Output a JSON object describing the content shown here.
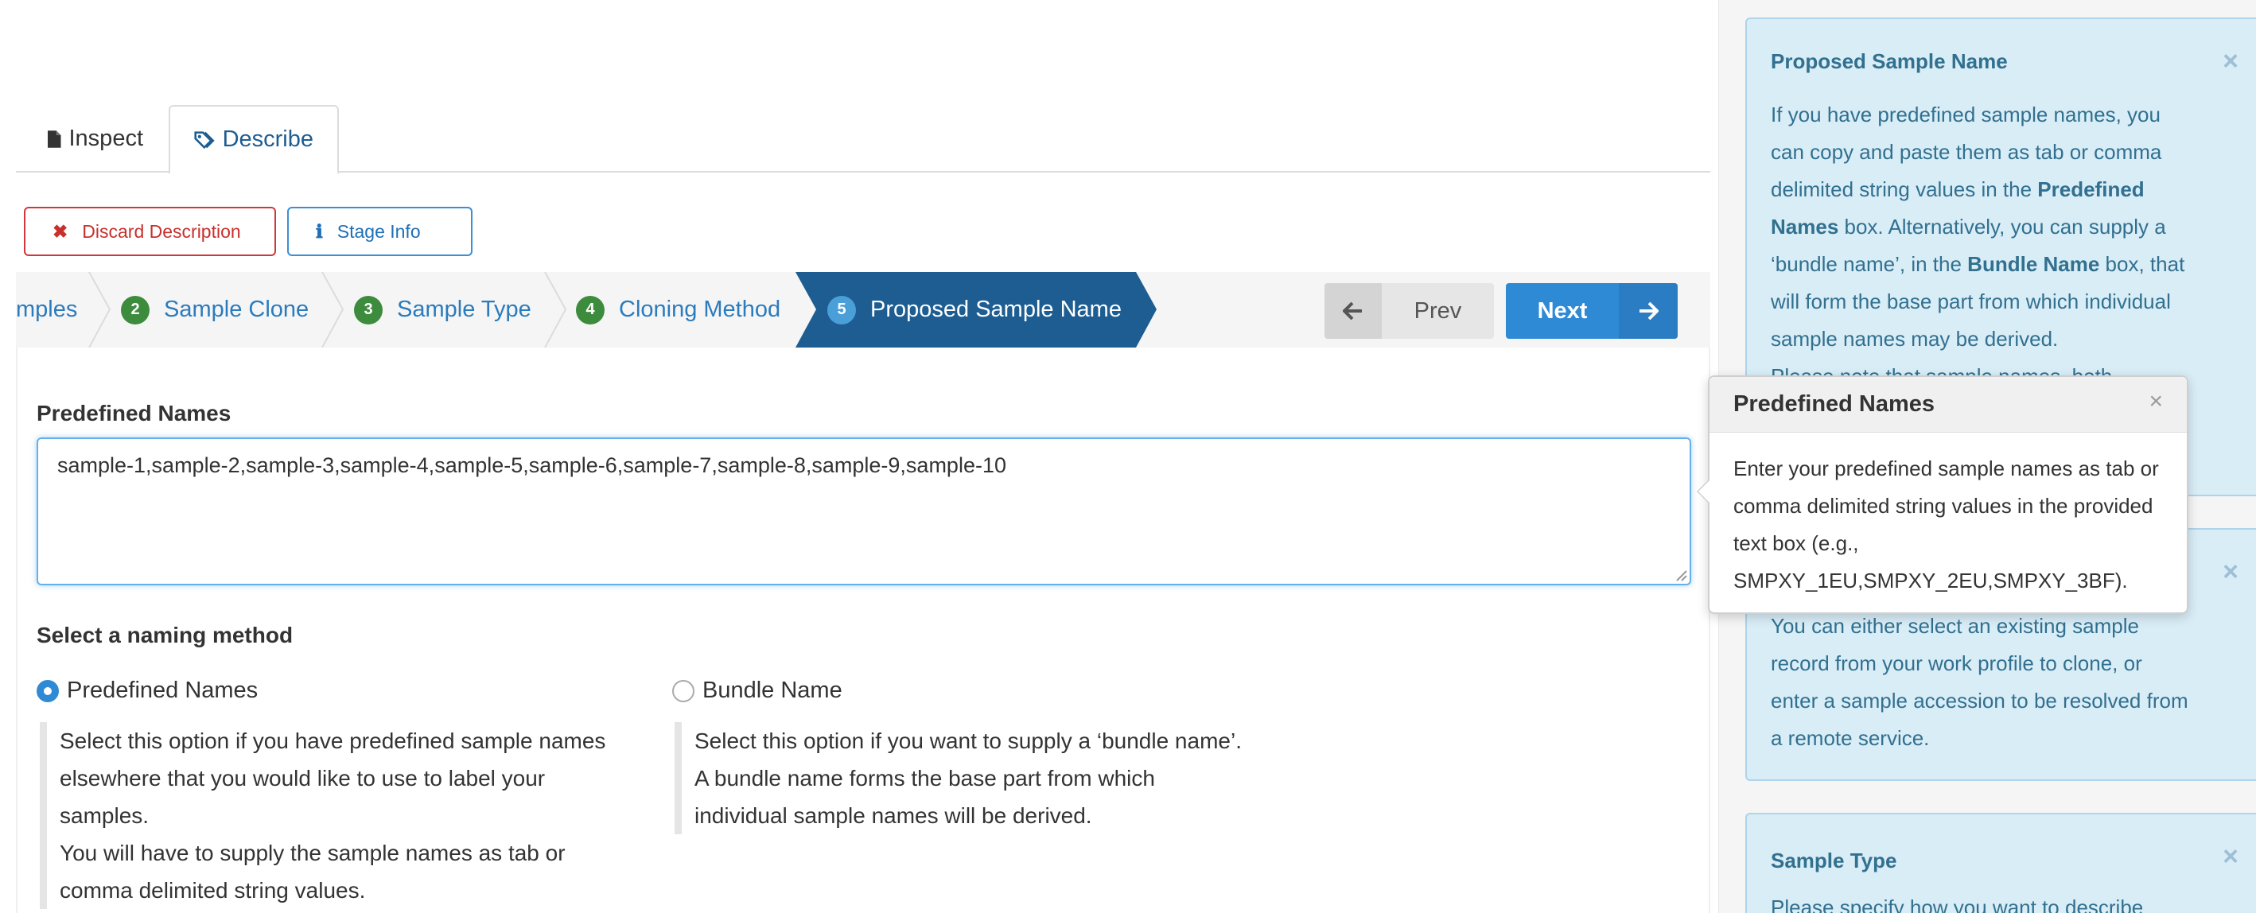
{
  "tabs": [
    {
      "label": "Inspect",
      "icon": "file-icon"
    },
    {
      "label": "Describe",
      "icon": "tags-icon",
      "active": true
    }
  ],
  "actions": {
    "discard_label": "Discard Description",
    "stage_label": "Stage Info"
  },
  "wizard": {
    "steps": [
      {
        "num": "",
        "label": "mples"
      },
      {
        "num": "2",
        "label": "Sample Clone"
      },
      {
        "num": "3",
        "label": "Sample Type"
      },
      {
        "num": "4",
        "label": "Cloning Method"
      },
      {
        "num": "5",
        "label": "Proposed Sample Name",
        "active": true
      }
    ],
    "prev_label": "Prev",
    "next_label": "Next"
  },
  "form": {
    "predefined_label": "Predefined Names",
    "predefined_value": "sample-1,sample-2,sample-3,sample-4,sample-5,sample-6,sample-7,sample-8,sample-9,sample-10",
    "naming_label": "Select a naming method",
    "options": [
      {
        "label": "Predefined Names",
        "selected": true,
        "desc": [
          "Select this option if you have predefined sample names",
          "elsewhere that you would like to use to label your",
          "samples.",
          "You will have to supply the sample names as tab or",
          "comma delimited string values."
        ]
      },
      {
        "label": "Bundle Name",
        "selected": false,
        "desc": [
          "Select this option if you want to supply a ‘bundle name’.",
          "A bundle name forms the base part from which",
          "individual sample names will be derived."
        ]
      }
    ]
  },
  "sidebar": {
    "cards": [
      {
        "title": "Proposed Sample Name",
        "close": "×",
        "lines": [
          "If you have predefined sample names, you",
          "can copy and paste them as tab or comma",
          "delimited string values in the ",
          "Predefined",
          "Names",
          " box. Alternatively, you can supply a",
          "‘bundle name’, in the ",
          "Bundle Name",
          " box, that",
          "will form the base part from which individual",
          "sample names may be derived.",
          "Please note that sample names, both"
        ]
      },
      {
        "title": "",
        "close": "×",
        "lines": [
          "You can either select an existing sample",
          "record from your work profile to clone, or",
          "enter a sample accession to be resolved from",
          "a remote service."
        ]
      },
      {
        "title": "Sample Type",
        "close": "×",
        "lines": [
          "Please specify how you want to describe"
        ]
      }
    ]
  },
  "popover": {
    "title": "Predefined Names",
    "close": "×",
    "lines": [
      "Enter your predefined sample names as tab or",
      "comma delimited string values in the provided",
      "text box (e.g.,",
      "SMPXY_1EU,SMPXY_2EU,SMPXY_3BF)."
    ]
  },
  "colors": {
    "primary": "#2f8ad6",
    "danger": "#c9302c",
    "active_step": "#1d5d92",
    "step_badge": "#3d8b3d",
    "info_bg": "#d9edf7",
    "info_text": "#31708f"
  }
}
